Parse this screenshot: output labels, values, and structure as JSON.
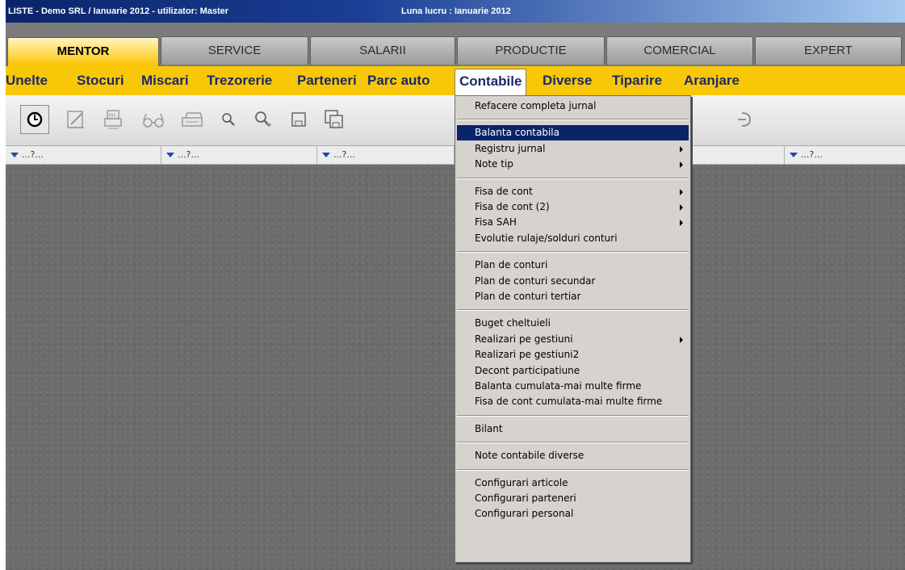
{
  "titlebar": {
    "left": "LISTE - Demo SRL / Ianuarie 2012 - utilizator: Master",
    "right": "Luna lucru : Ianuarie 2012"
  },
  "tabs": [
    "MENTOR",
    "SERVICE",
    "SALARII",
    "PRODUCTIE",
    "COMERCIAL",
    "EXPERT"
  ],
  "active_tab": "MENTOR",
  "menu": [
    "Unelte",
    "Stocuri",
    "Miscari",
    "Trezorerie",
    "Parteneri",
    "Parc auto",
    "Contabile",
    "Diverse",
    "Tiparire",
    "Aranjare"
  ],
  "open_menu": "Contabile",
  "filters": [
    "...?...",
    "...?...",
    "...?...",
    "...?..."
  ],
  "toolbar_icons": [
    "clock-icon",
    "edit-document-icon",
    "print-form-icon",
    "glasses-icon",
    "printer-icon",
    "search-icon",
    "search-advanced-icon",
    "save-icon",
    "save-all-icon",
    "exit-icon"
  ],
  "dropdown": {
    "items": [
      {
        "label": "Refacere completa jurnal",
        "submenu": false
      },
      {
        "sep": true
      },
      {
        "label": "Balanta contabila",
        "submenu": false,
        "selected": true
      },
      {
        "label": "Registru jurnal",
        "submenu": true
      },
      {
        "label": "Note tip",
        "submenu": true
      },
      {
        "sep": true
      },
      {
        "label": "Fisa de cont",
        "submenu": true
      },
      {
        "label": "Fisa de cont (2)",
        "submenu": true
      },
      {
        "label": "Fisa SAH",
        "submenu": true
      },
      {
        "label": "Evolutie rulaje/solduri conturi",
        "submenu": false
      },
      {
        "sep": true
      },
      {
        "label": "Plan de conturi",
        "submenu": false
      },
      {
        "label": "Plan de conturi secundar",
        "submenu": false
      },
      {
        "label": "Plan de conturi tertiar",
        "submenu": false
      },
      {
        "sep": true
      },
      {
        "label": "Buget cheltuieli",
        "submenu": false
      },
      {
        "label": "Realizari pe gestiuni",
        "submenu": true
      },
      {
        "label": "Realizari pe gestiuni2",
        "submenu": false
      },
      {
        "label": "Decont participatiune",
        "submenu": false
      },
      {
        "label": "Balanta cumulata-mai multe firme",
        "submenu": false
      },
      {
        "label": "Fisa de cont cumulata-mai multe firme",
        "submenu": false
      },
      {
        "sep": true
      },
      {
        "label": "Bilant",
        "submenu": false
      },
      {
        "sep": true
      },
      {
        "label": "Note contabile diverse",
        "submenu": false
      },
      {
        "sep": true
      },
      {
        "label": "Configurari articole",
        "submenu": false
      },
      {
        "label": "Configurari parteneri",
        "submenu": false
      },
      {
        "label": "Configurari personal",
        "submenu": false
      }
    ]
  },
  "colors": {
    "menubar": "#f8c808",
    "menu_text": "#1a2a6c",
    "selection": "#0a246a",
    "active_tab": "#ffd23a"
  }
}
